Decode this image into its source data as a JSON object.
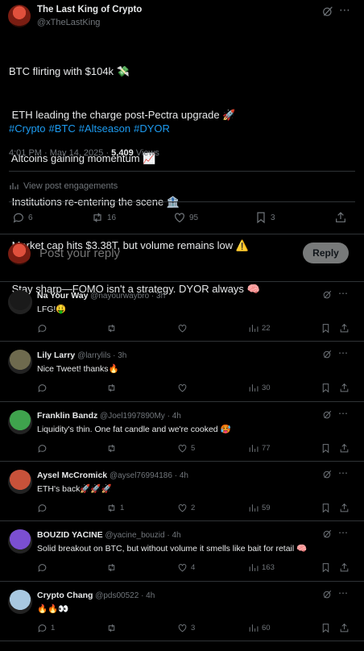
{
  "post": {
    "author_name": "The Last King of Crypto",
    "author_handle": "@xTheLastKing",
    "lines": [
      "BTC flirting with $104k 💸",
      " ETH leading the charge post-Pectra upgrade 🚀",
      " Altcoins gaining momentum 📈",
      " Institutions re-entering the scene 🏦",
      " Market cap hits $3.38T, but volume remains low ⚠️",
      " Stay sharp—FOMO isn't a strategy. DYOR always 🧠"
    ],
    "hashtags": [
      "#Crypto",
      "#BTC",
      "#Altseason",
      "#DYOR"
    ],
    "timestamp": "4:01 PM · May 14, 2025 · ",
    "views_count": "5,409",
    "views_label": " Views",
    "engagements_label": "View post engagements",
    "actions": {
      "replies": "6",
      "reposts": "16",
      "likes": "95",
      "bookmarks": "3"
    }
  },
  "reply_box": {
    "placeholder": "Post your reply",
    "button_label": "Reply"
  },
  "comments": [
    {
      "name": "Na Your Way",
      "handle": "@nayourwaybro · 3h",
      "text": "LFG!🤑",
      "replies": "",
      "reposts": "",
      "likes": "",
      "views": "22",
      "avatar_color": "#1a1a1a"
    },
    {
      "name": "Lily Larry",
      "handle": "@larrylils · 3h",
      "text": "Nice Tweet! thanks🔥",
      "replies": "",
      "reposts": "",
      "likes": "",
      "views": "30",
      "avatar_color": "#6e6a4e"
    },
    {
      "name": "Franklin Bandz",
      "handle": "@Joel1997890My · 4h",
      "text": "Liquidity's thin. One fat candle and we're cooked 🥵",
      "replies": "",
      "reposts": "",
      "likes": "5",
      "views": "77",
      "avatar_color": "#3fa34d"
    },
    {
      "name": "Aysel McCromick",
      "handle": "@aysel76994186 · 4h",
      "text": "ETH's back🚀🚀🚀",
      "replies": "",
      "reposts": "1",
      "likes": "2",
      "views": "59",
      "avatar_color": "#c8523a"
    },
    {
      "name": "BOUZID YACINE",
      "handle": "@yacine_bouzid · 4h",
      "text": "Solid breakout on BTC, but without volume it smells like bait for retail 🧠",
      "replies": "",
      "reposts": "",
      "likes": "4",
      "views": "163",
      "avatar_color": "#7b4fd1"
    },
    {
      "name": "Crypto Chang",
      "handle": "@pds00522 · 4h",
      "text": "🔥🔥👀",
      "replies": "1",
      "reposts": "",
      "likes": "3",
      "views": "60",
      "avatar_color": "#a8c8e0"
    }
  ]
}
